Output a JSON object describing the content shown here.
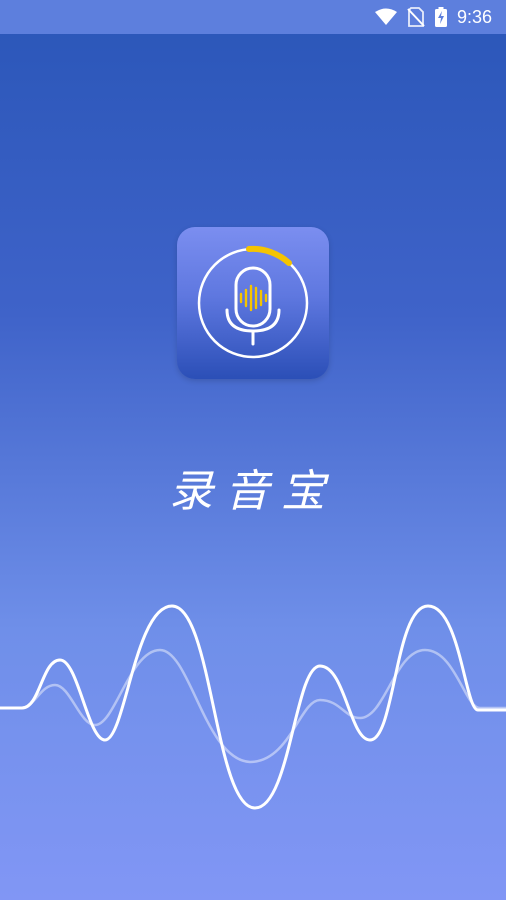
{
  "status_bar": {
    "time": "9:36",
    "icons": [
      "wifi-icon",
      "no-sim-icon",
      "battery-charging-icon"
    ]
  },
  "splash": {
    "app_icon": "microphone-icon",
    "app_name": "录音宝"
  },
  "colors": {
    "status_bar": "#5d7fdd",
    "background_top": "#2a56b8",
    "background_bottom": "#8196f5",
    "accent": "#f5c400"
  }
}
